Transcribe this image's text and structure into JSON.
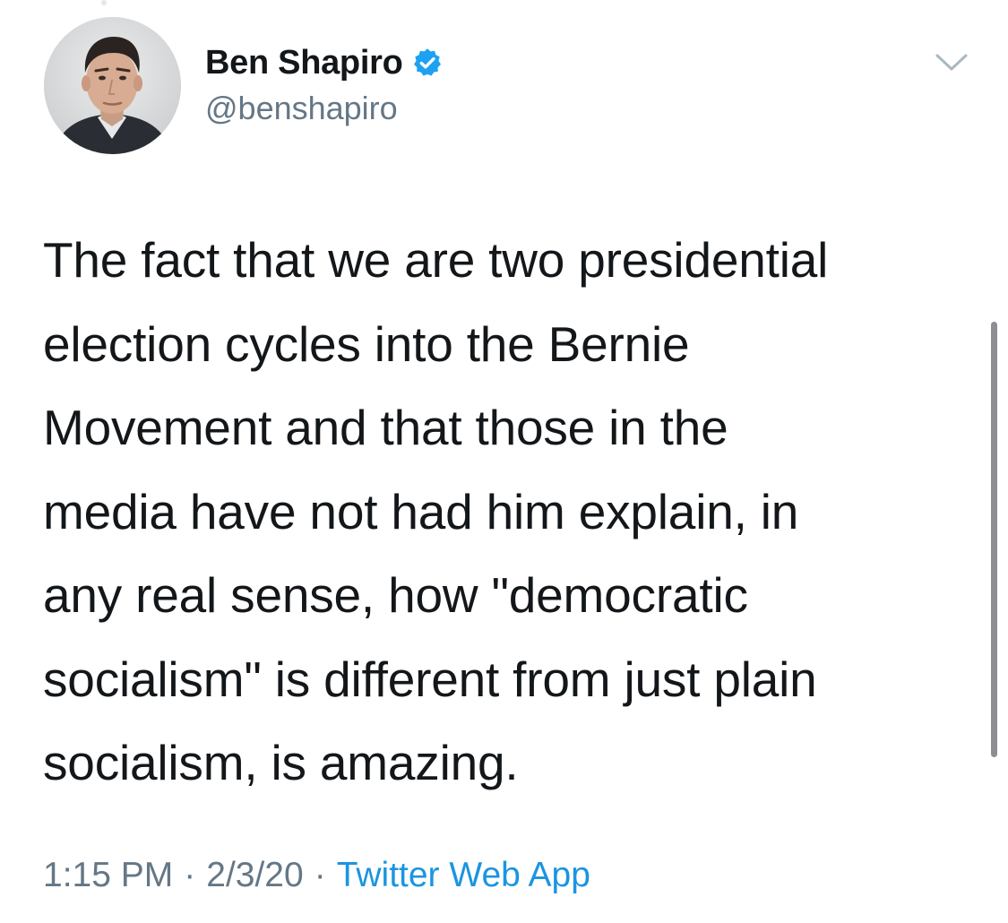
{
  "tweet": {
    "author": {
      "display_name": "Ben Shapiro",
      "handle": "@benshapiro",
      "verified": true,
      "avatar": "profile-photo"
    },
    "text": "The fact that we are two presidential\nelection cycles into the Bernie\nMovement and that those in the\nmedia have not had him explain, in\nany real sense, how \"democratic\nsocialism\" is different from just plain\nsocialism, is amazing.",
    "time": "1:15 PM",
    "date": "2/3/20",
    "separator": "·",
    "source": "Twitter Web App"
  },
  "icons": {
    "verified": "verified-badge-icon",
    "more": "chevron-down-icon"
  },
  "colors": {
    "primary_text": "#14171a",
    "secondary_text": "#657786",
    "link": "#1b95e0",
    "verified": "#1da1f2"
  }
}
